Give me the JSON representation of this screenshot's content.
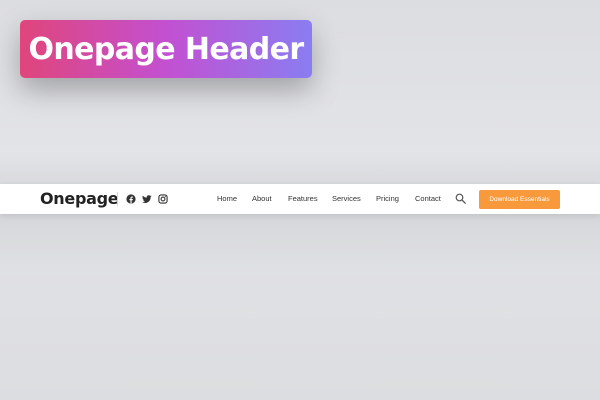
{
  "banner": {
    "title": "Onepage Header"
  },
  "header": {
    "logo_text": "Onepage",
    "social_icons": [
      "facebook-icon",
      "twitter-icon",
      "instagram-icon"
    ],
    "nav_items": [
      {
        "label": "Home"
      },
      {
        "label": "About"
      },
      {
        "label": "Features"
      },
      {
        "label": "Services"
      },
      {
        "label": "Pricing"
      },
      {
        "label": "Contact"
      }
    ],
    "search_icon": "search-icon",
    "cta_label": "Download Essentials"
  },
  "colors": {
    "banner_gradient": [
      "#e0457b",
      "#c350d1",
      "#8a7df2"
    ],
    "cta": "#f89a3b",
    "background": "#dfe0e3",
    "header_bg": "#ffffff"
  }
}
